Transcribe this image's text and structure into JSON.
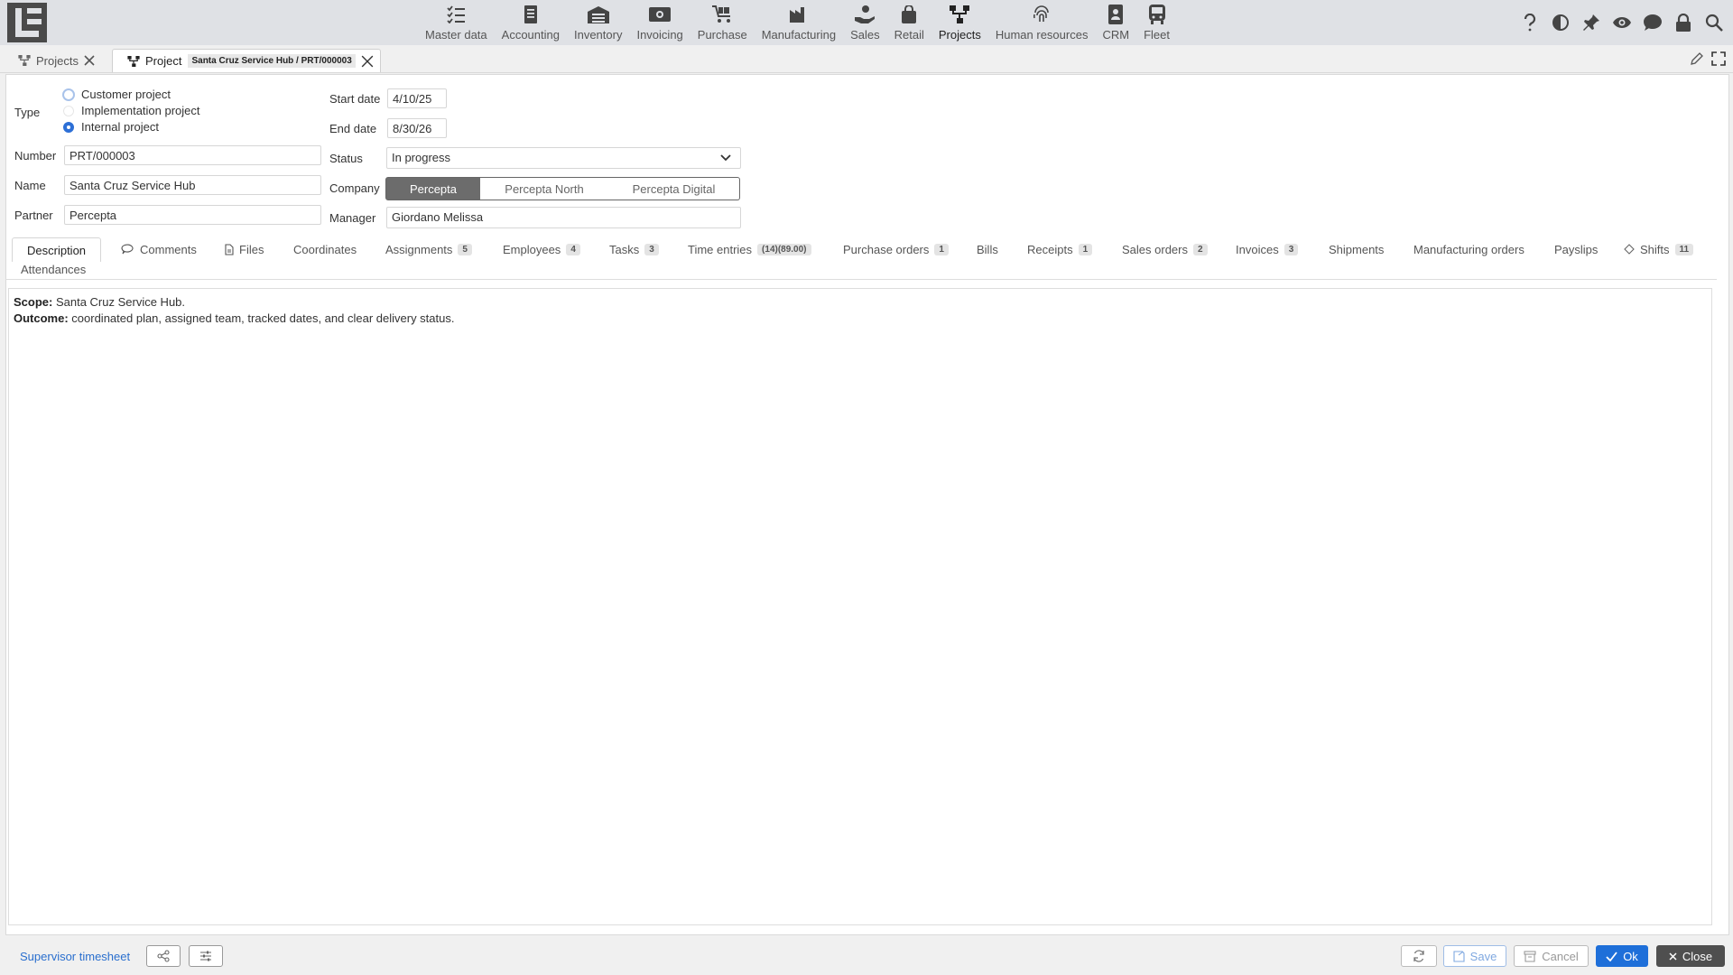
{
  "topbar": {
    "modules": [
      {
        "label": "Master data",
        "icon": "checklist-icon"
      },
      {
        "label": "Accounting",
        "icon": "ledger-icon"
      },
      {
        "label": "Inventory",
        "icon": "warehouse-icon"
      },
      {
        "label": "Invoicing",
        "icon": "banknote-icon"
      },
      {
        "label": "Purchase",
        "icon": "cart-icon"
      },
      {
        "label": "Manufacturing",
        "icon": "factory-icon"
      },
      {
        "label": "Sales",
        "icon": "hand-coin-icon"
      },
      {
        "label": "Retail",
        "icon": "shopping-bag-icon"
      },
      {
        "label": "Projects",
        "icon": "project-tree-icon",
        "active": true
      },
      {
        "label": "Human resources",
        "icon": "fingerprint-icon"
      },
      {
        "label": "CRM",
        "icon": "contact-card-icon"
      },
      {
        "label": "Fleet",
        "icon": "bus-icon"
      }
    ],
    "tools": [
      "help-icon",
      "contrast-icon",
      "pin-icon",
      "eye-icon",
      "chat-icon",
      "lock-icon",
      "search-icon"
    ]
  },
  "tabs": {
    "projects": "Projects",
    "project": "Project",
    "project_badge": "Santa Cruz Service Hub / PRT/000003"
  },
  "form": {
    "type_label": "Type",
    "type_options": [
      "Customer project",
      "Implementation project",
      "Internal project"
    ],
    "type_selected": "Internal project",
    "start_date_label": "Start date",
    "start_date": "4/10/25",
    "end_date_label": "End date",
    "end_date": "8/30/26",
    "number_label": "Number",
    "number": "PRT/000003",
    "status_label": "Status",
    "status": "In progress",
    "name_label": "Name",
    "name": "Santa Cruz Service Hub",
    "company_label": "Company",
    "companies": [
      "Percepta",
      "Percepta North",
      "Percepta Digital"
    ],
    "company_selected": "Percepta",
    "partner_label": "Partner",
    "partner": "Percepta",
    "manager_label": "Manager",
    "manager": "Giordano Melissa"
  },
  "subtabs": {
    "description": "Description",
    "comments": "Comments",
    "files": "Files",
    "coordinates": "Coordinates",
    "assignments": "Assignments",
    "assignments_count": "5",
    "employees": "Employees",
    "employees_count": "4",
    "tasks": "Tasks",
    "tasks_count": "3",
    "time_entries": "Time entries",
    "time_entries_count": "(14)(89.00)",
    "purchase_orders": "Purchase orders",
    "purchase_orders_count": "1",
    "bills": "Bills",
    "receipts": "Receipts",
    "receipts_count": "1",
    "sales_orders": "Sales orders",
    "sales_orders_count": "2",
    "invoices": "Invoices",
    "invoices_count": "3",
    "shipments": "Shipments",
    "manufacturing_orders": "Manufacturing orders",
    "payslips": "Payslips",
    "shifts": "Shifts",
    "shifts_count": "11",
    "attendances": "Attendances"
  },
  "description": {
    "scope_label": "Scope:",
    "scope_text": " Santa Cruz Service Hub.",
    "outcome_label": "Outcome:",
    "outcome_text": " coordinated plan, assigned team, tracked dates, and clear delivery status."
  },
  "bottom": {
    "supervisor_link": "Supervisor timesheet",
    "save": "Save",
    "cancel": "Cancel",
    "ok": "Ok",
    "close": "Close"
  },
  "colors": {
    "accent": "#1e6fd9",
    "topbar": "#dfe1e5",
    "segment_active": "#6c6c6c",
    "close_button": "#4f4f4f"
  }
}
